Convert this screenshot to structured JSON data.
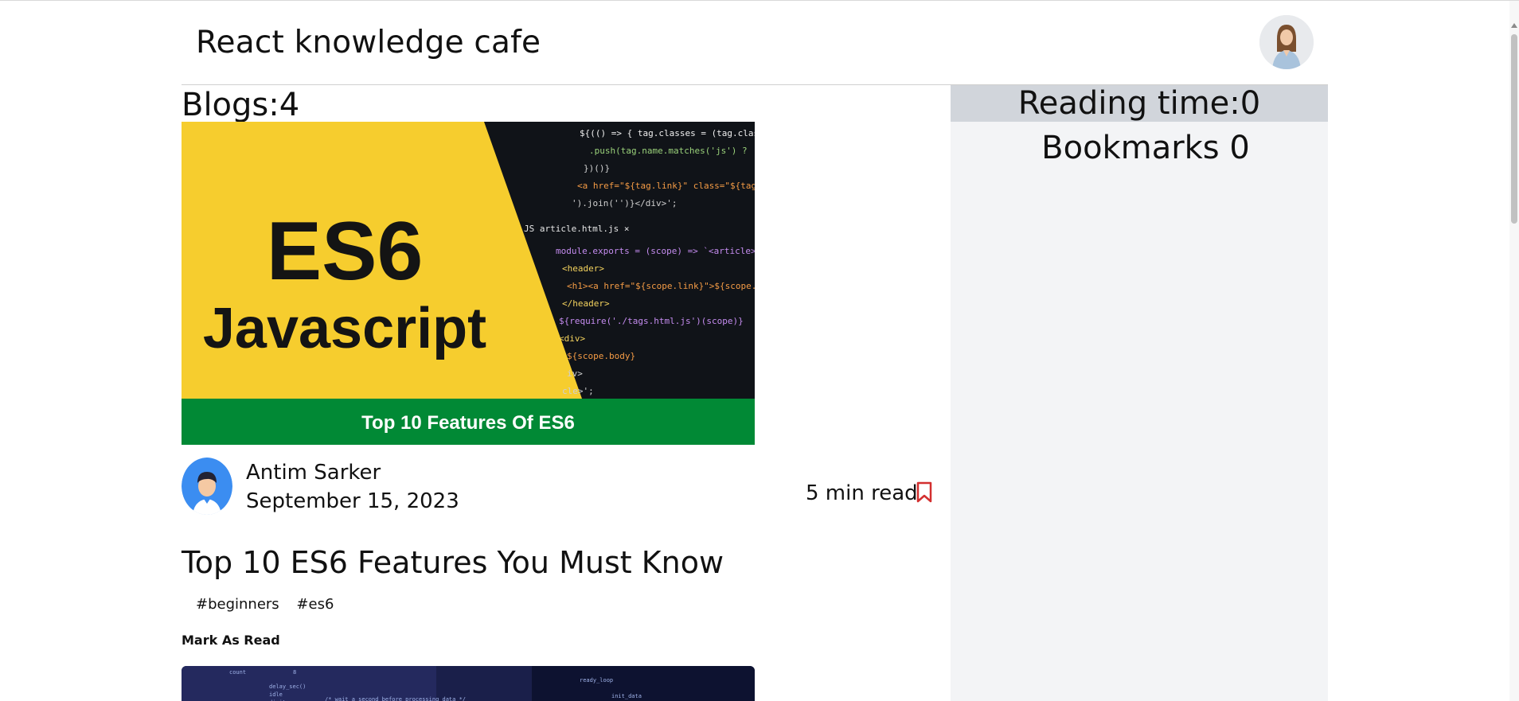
{
  "header": {
    "title": "React knowledge cafe"
  },
  "blogs": {
    "count_label": "Blogs:4",
    "post": {
      "cover_heading": "ES6",
      "cover_subheading": "Javascript",
      "cover_banner": "Top 10 Features Of ES6",
      "author_name": "Antim Sarker",
      "date": "September 15, 2023",
      "read_time": "5 min read",
      "title": "Top 10 ES6 Features You Must Know",
      "tags": [
        "#beginners",
        "#es6"
      ],
      "mark_read_label": "Mark As Read"
    }
  },
  "sidebar": {
    "reading_time_label": "Reading time:0",
    "bookmarks_label": "Bookmarks 0"
  },
  "colors": {
    "cover_yellow": "#f6cd2e",
    "cover_green": "#018935",
    "sidebar_bg": "#f3f4f6",
    "reading_time_bg": "#d1d5db",
    "bookmark_icon": "#d32f2f"
  },
  "icons": {
    "bookmark": "bookmark-icon",
    "avatar": "user-avatar-icon"
  }
}
